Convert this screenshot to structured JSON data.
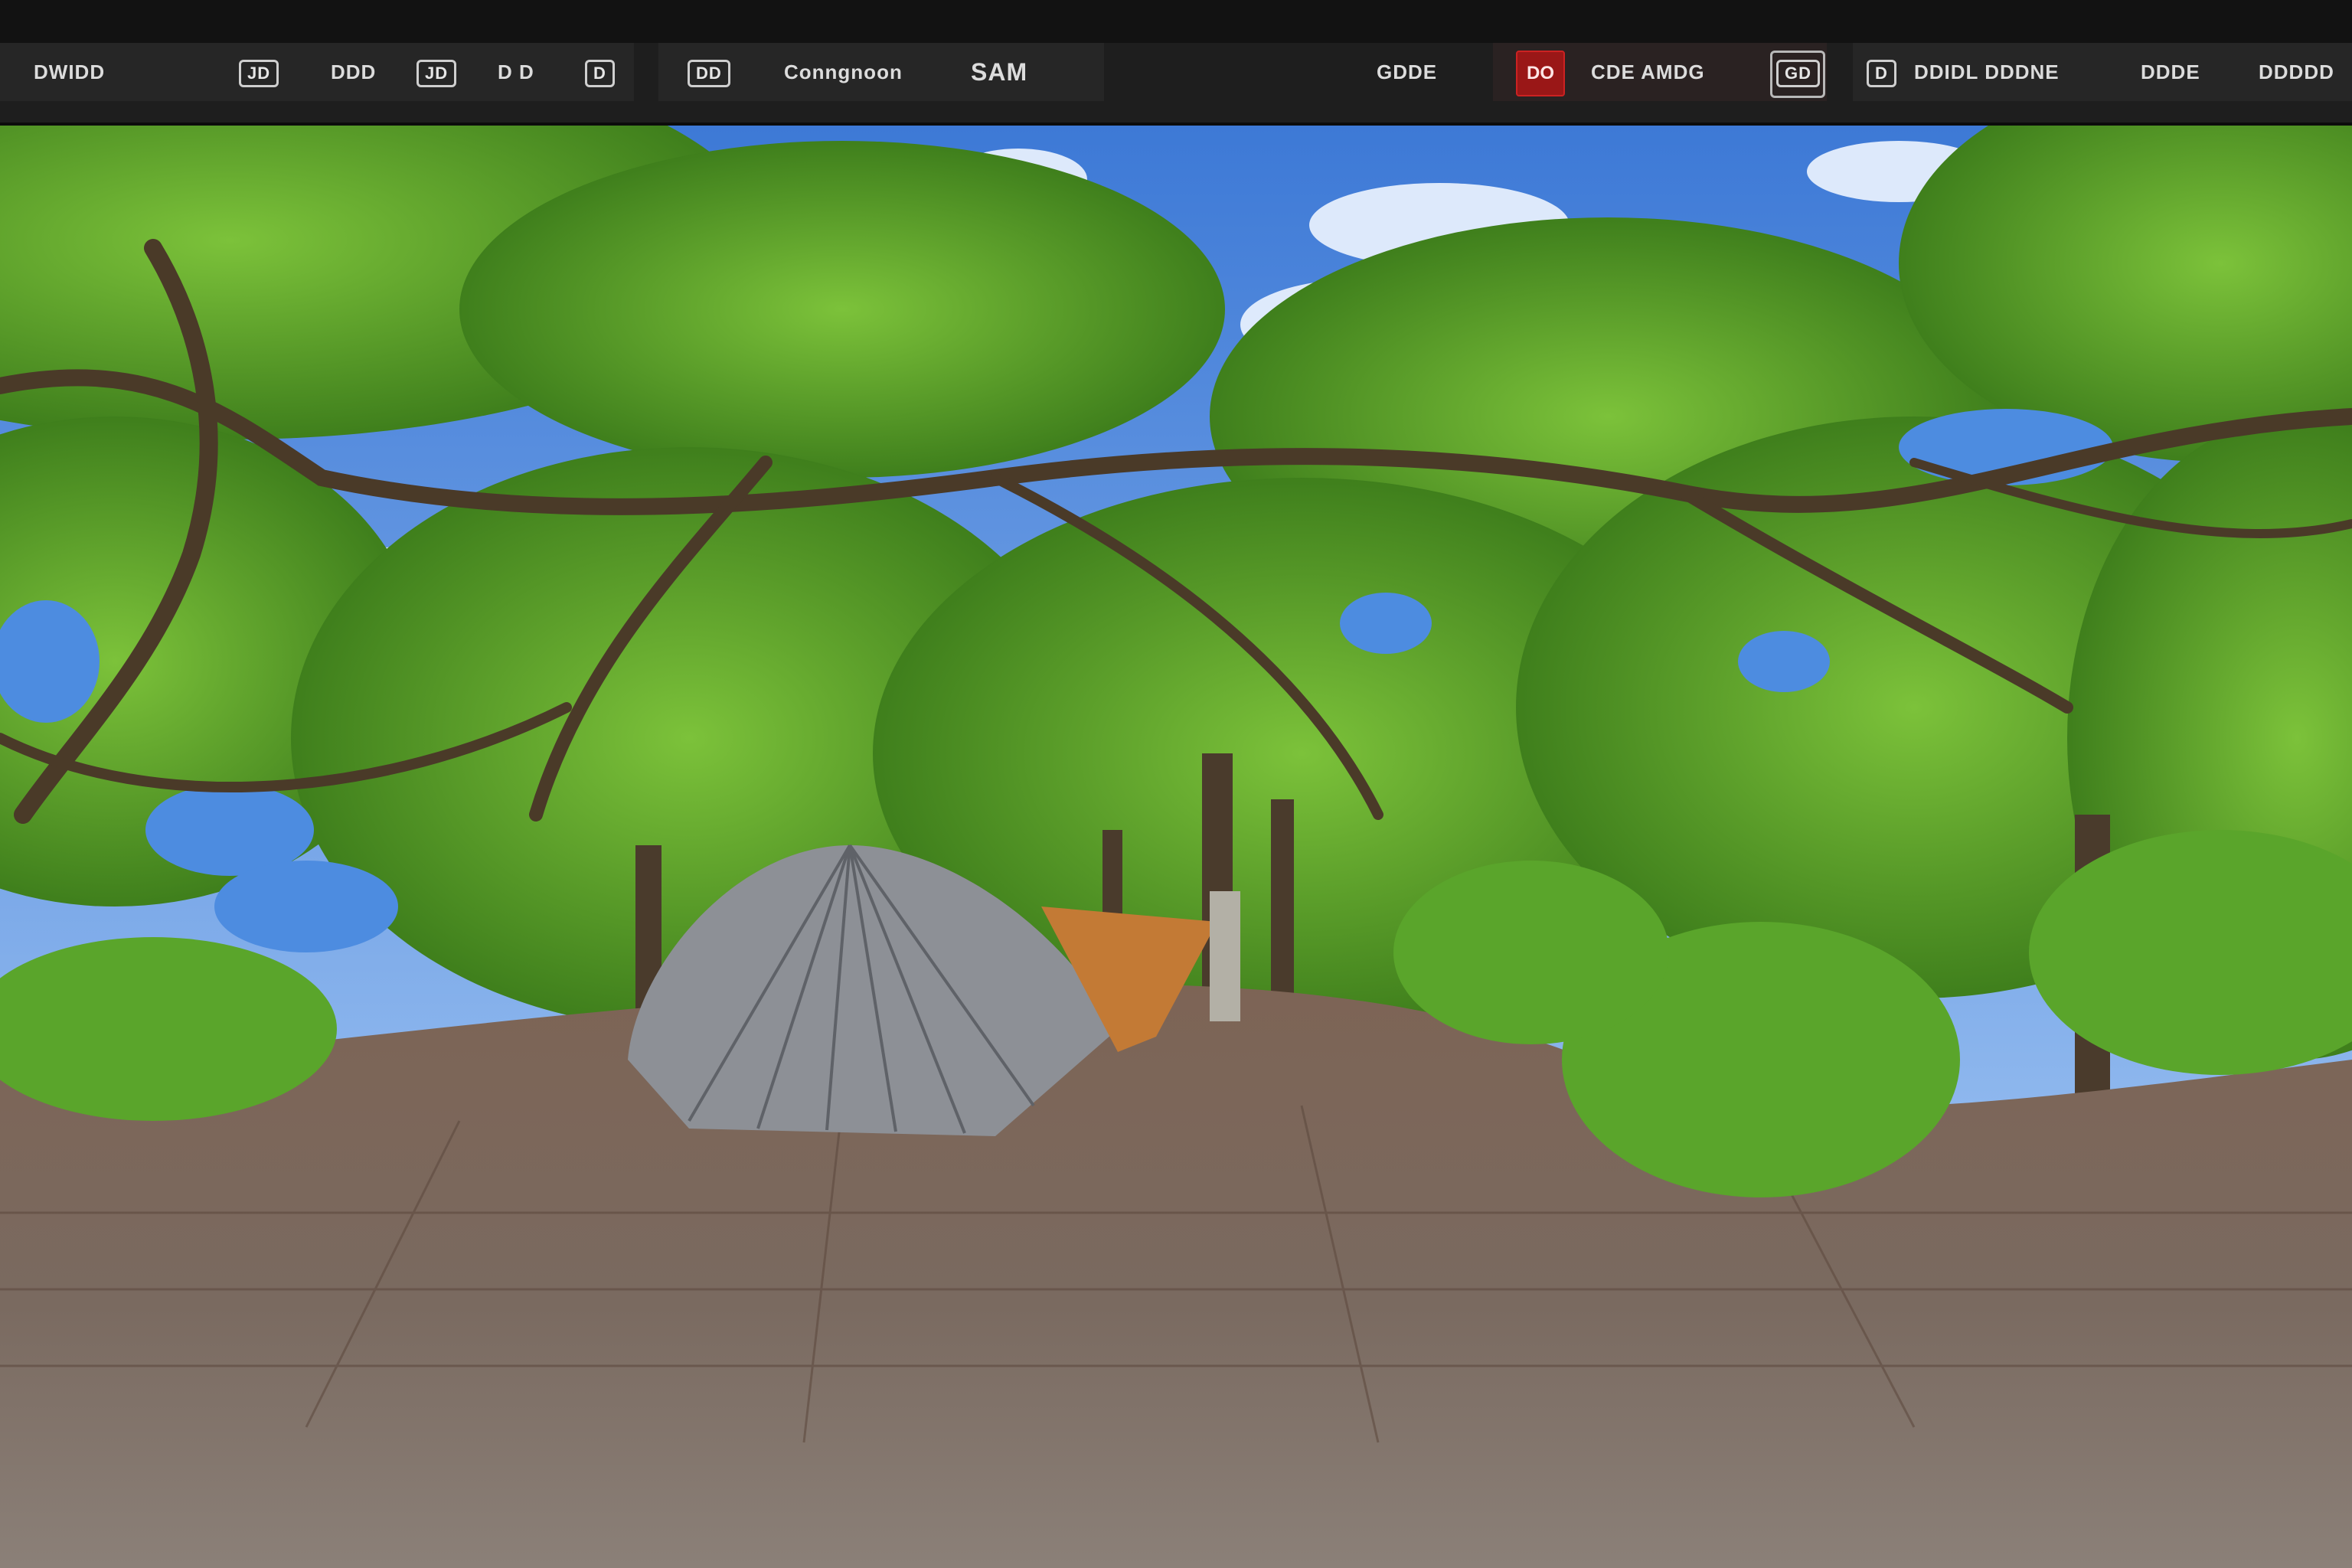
{
  "toolbar": {
    "left_label": "DWIDD",
    "btn_a": "JD",
    "btn_b": "DDD",
    "btn_c": "JD",
    "btn_d": "D D",
    "btn_e": "D",
    "btn_f": "DD",
    "mode_label": "Conngnoon",
    "mode_value": "SAM",
    "btn_g": "GDDE",
    "record_label": "DO",
    "filter_label": "CDE AMDG",
    "filter_badge": "GD",
    "view_icon_label": "D",
    "view_label": "DDIDL DDDNE",
    "btn_h": "DDDE",
    "right_label": "DDDDD"
  },
  "colors": {
    "toolbar_bg": "#1e1e1e",
    "accent_red": "#9a1717",
    "sky": "#4a86e0",
    "foliage": "#5fa42e",
    "path": "#7a6556"
  },
  "viewport": {
    "content": "360-panorama-forest-path"
  }
}
